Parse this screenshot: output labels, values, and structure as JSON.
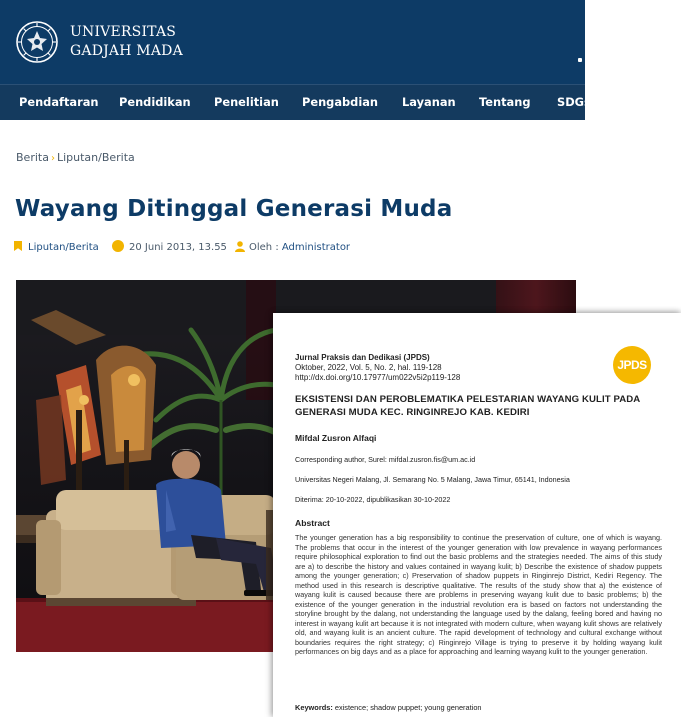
{
  "site": {
    "brand_line1": "UNIVERSITAS",
    "brand_line2": "GADJAH MADA",
    "nav": [
      "Pendaftaran",
      "Pendidikan",
      "Penelitian",
      "Pengabdian",
      "Layanan",
      "Tentang",
      "SDGs"
    ],
    "breadcrumb": {
      "home": "Berita",
      "current": "Liputan/Berita"
    },
    "title": "Wayang Ditinggal Generasi Muda",
    "meta": {
      "category": "Liputan/Berita",
      "date": "20 Juni 2013, 13.55",
      "author_prefix": "Oleh :",
      "author": "Administrator"
    }
  },
  "paper": {
    "journal": "Jurnal Praksis dan Dedikasi (JPDS)",
    "issue": "Oktober, 2022, Vol. 5, No. 2, hal. 119-128",
    "doi": "http://dx.doi.org/10.17977/um022v5i2p119-128",
    "logo_text": "JPDS",
    "title": "EKSISTENSI DAN PEROBLEMATIKA PELESTARIAN WAYANG KULIT PADA GENERASI MUDA KEC. RINGINREJO KAB. KEDIRI",
    "author": "Mifdal Zusron Alfaqi",
    "corresponding": "Corresponding author, Surel: mifdal.zusron.fis@um.ac.id",
    "affiliation": "Universitas Negeri Malang, Jl. Semarang No. 5 Malang, Jawa Timur, 65141, Indonesia",
    "dates": "Diterima: 20-10-2022, dipublikasikan 30-10-2022",
    "abstract_heading": "Abstract",
    "abstract": "The younger generation has a big responsibility to continue the preservation of culture, one of which is wayang. The problems that occur in the interest of the younger generation with low prevalence in wayang performances require philosophical exploration to find out the basic problems and the strategies needed. The aims of this study are a) to describe the history and values contained in wayang kulit; b) Describe the existence of shadow puppets among the younger generation; c) Preservation of shadow puppets in Ringinrejo District, Kediri Regency. The method used in this research is descriptive qualitative. The results of the study show that a) the existence of wayang kulit is caused because there are problems in preserving wayang kulit due to basic problems; b) the existence of the younger generation in the industrial revolution era is based on factors not understanding the storyline brought by the dalang, not understanding the language used by the dalang, feeling bored and having no interest in wayang kulit art because it is not integrated with modern culture, when wayang kulit shows are relatively old, and wayang kulit is an ancient culture. The rapid development of technology and cultural exchange without boundaries requires the right strategy; c) Ringinrejo Village is trying to preserve it by holding wayang kulit performances on big days and as a place for approaching and learning wayang kulit to the younger generation.",
    "keywords_label": "Keywords:",
    "keywords": "existence; shadow puppet; young generation"
  }
}
